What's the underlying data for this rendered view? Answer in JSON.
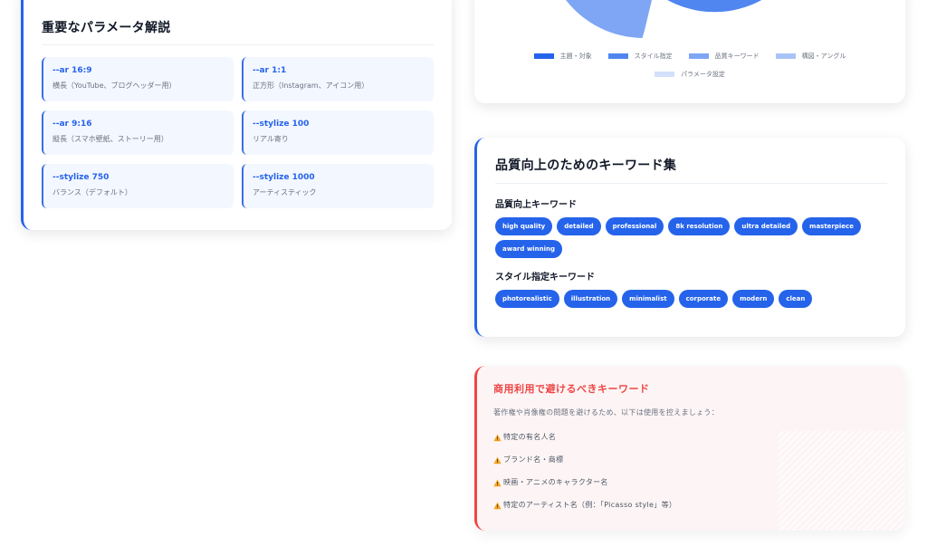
{
  "params_card": {
    "title": "重要なパラメータ解説",
    "items": [
      {
        "code": "--ar 16:9",
        "desc": "横長（YouTube、ブログヘッダー用）"
      },
      {
        "code": "--ar 1:1",
        "desc": "正方形（Instagram、アイコン用）"
      },
      {
        "code": "--ar 9:16",
        "desc": "縦長（スマホ壁紙、ストーリー用）"
      },
      {
        "code": "--stylize 100",
        "desc": "リアル寄り"
      },
      {
        "code": "--stylize 750",
        "desc": "バランス（デフォルト）"
      },
      {
        "code": "--stylize 1000",
        "desc": "アーティスティック"
      }
    ]
  },
  "chart_card": {
    "chart_data": {
      "type": "pie",
      "title": "",
      "legend_placement": "bottom",
      "series": [
        {
          "name": "主題・対象",
          "color": "#2563eb"
        },
        {
          "name": "スタイル指定",
          "color": "#4f86f0"
        },
        {
          "name": "品質キーワード",
          "color": "#7ea6f4"
        },
        {
          "name": "構図・アングル",
          "color": "#a9c3f7"
        },
        {
          "name": "パラメータ設定",
          "color": "#d3e0fb"
        }
      ]
    }
  },
  "keywords_card": {
    "title": "品質向上のためのキーワード集",
    "quality": {
      "title": "品質向上キーワード",
      "tags": [
        "high quality",
        "detailed",
        "professional",
        "8k resolution",
        "ultra detailed",
        "masterpiece",
        "award winning"
      ]
    },
    "style": {
      "title": "スタイル指定キーワード",
      "tags": [
        "photorealistic",
        "illustration",
        "minimalist",
        "corporate",
        "modern",
        "clean"
      ]
    }
  },
  "warning_card": {
    "title": "商用利用で避けるべきキーワード",
    "description": "著作権や肖像権の問題を避けるため、以下は使用を控えましょう：",
    "items": [
      "特定の有名人名",
      "ブランド名・商標",
      "映画・アニメのキャラクター名",
      "特定のアーティスト名（例：「Picasso style」等）"
    ],
    "icon": "warning-icon",
    "accent_color": "#ef4444"
  }
}
